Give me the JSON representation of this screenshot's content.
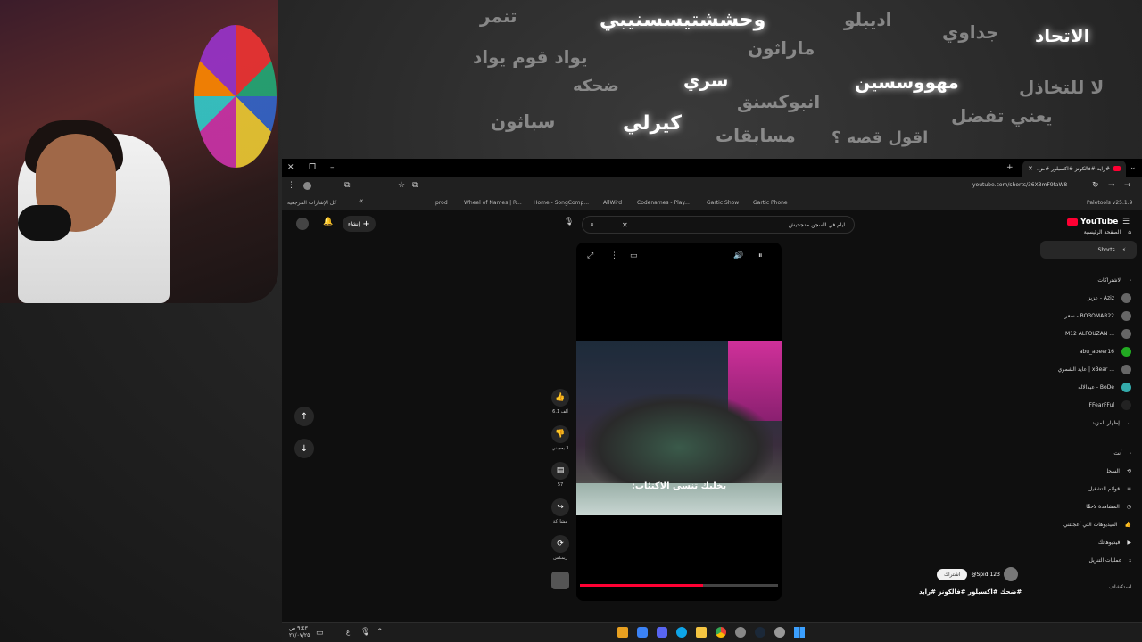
{
  "banner": {
    "words": [
      "الاتحاد",
      "جداوي",
      "اديبلو",
      "وحششتيسسنيبي",
      "تنمر",
      "ماراثون",
      "يواد قوم يواد",
      "لا للتخاذل",
      "مهووسسين",
      "سري",
      "ضحكه",
      "انبوكسنق",
      "يعني تفضل",
      "سباثون",
      "كيرلي",
      "مسابقات",
      "اقول قصه ؟"
    ]
  },
  "browser": {
    "tab_title": "#رايد #فالكونز #اكسبلور #ض...",
    "url": "youtube.com/shorts/36X3mF9faW8",
    "extension_label": "Paletools v25.1.9",
    "bookmarks": [
      "prod",
      "Wheel of Names | R...",
      "Home - SongComp...",
      "AllWird",
      "Codenames - Play...",
      "Gartic Show",
      "Gartic Phone"
    ],
    "all_bookmarks_label": "كل الإشارات المرجعية"
  },
  "youtube": {
    "logo": "YouTube",
    "create_label": "إنشاء",
    "search_value": "ايام في السجن مدجحيش",
    "nav": {
      "home": "الصفحة الرئيسية",
      "shorts": "Shorts"
    },
    "subscriptions_title": "الاشتراكات",
    "subscriptions": [
      "عزيز - Aziz",
      "سعر - BO3OMAR22",
      "M12 ALFOUZAN ...",
      "abu_abeer16",
      "عايد الشمري | xBear ...",
      "عبدالاله - BoDe",
      "FFearFFul"
    ],
    "show_more": "إظهار المزيد",
    "you_title": "أنت",
    "you_items": [
      "السجل",
      "قوائم التشغيل",
      "المشاهدة لاحقًا",
      "الفيديوهات التي أعجبتني",
      "فيديوهاتك",
      "عمليات التنزيل"
    ],
    "explore_title": "استكشاف",
    "video": {
      "subtitle": "يخليك تنسى الاكتئاب:",
      "channel": "@Spid.123",
      "subscribe_label": "اشتراك",
      "caption": "#ضحك #اكسبلور #فالكونز #رايد",
      "likes": "6.1 ألف",
      "dislike_label": "لا يعجبني",
      "comments": "57",
      "share_label": "مشاركة",
      "remix_label": "ريمكس",
      "progress": 0.62
    }
  },
  "taskbar": {
    "time": "٩:٤٣ ص",
    "date": "٢٧/٠٧/٢٥",
    "lang": "ع"
  },
  "colors": {
    "yt_red": "#ff0033",
    "banner_glow": "#ffffff",
    "background": "#1e1e1e"
  }
}
